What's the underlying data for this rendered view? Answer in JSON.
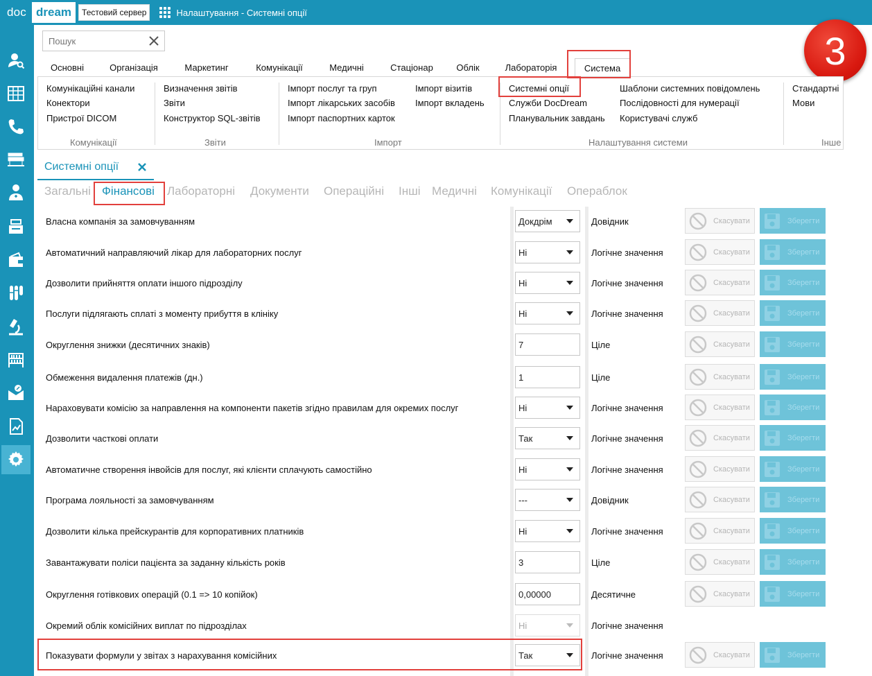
{
  "app": {
    "logo_doc": "doc",
    "logo_dream": "dream",
    "server": "Тестовий сервер",
    "window_title": "Налаштування - Системні опції",
    "step_badge": "3",
    "accent_color": "#1a93b8",
    "highlight_color": "#e2403c"
  },
  "sidebar": {
    "items": [
      {
        "icon": "user-search-icon",
        "active": false
      },
      {
        "icon": "calendar-grid-icon",
        "active": false
      },
      {
        "icon": "phone-icon",
        "active": false
      },
      {
        "icon": "hospital-bed-icon",
        "active": false
      },
      {
        "icon": "doctor-icon",
        "active": false
      },
      {
        "icon": "cash-register-icon",
        "active": false
      },
      {
        "icon": "wallet-icon",
        "active": false
      },
      {
        "icon": "test-tubes-icon",
        "active": false
      },
      {
        "icon": "microscope-icon",
        "active": false
      },
      {
        "icon": "warehouse-icon",
        "active": false
      },
      {
        "icon": "discount-envelope-icon",
        "active": false
      },
      {
        "icon": "report-icon",
        "active": false
      },
      {
        "icon": "gear-icon",
        "active": true
      }
    ]
  },
  "search": {
    "placeholder": "Пошук",
    "value": ""
  },
  "ribbon": {
    "tabs": [
      "Основні",
      "Організація",
      "Маркетинг",
      "Комунікації",
      "Медичні",
      "Стаціонар",
      "Облік",
      "Лабораторія",
      "Система"
    ],
    "active_tab": "Система",
    "groups": [
      {
        "label": "Комунікації",
        "items": [
          "Комунікаційні канали",
          "Конектори",
          "Пристрої DICOM"
        ]
      },
      {
        "label": "Звіти",
        "items": [
          "Визначення звітів",
          "Звіти",
          "Конструктор SQL-звітів"
        ]
      },
      {
        "label": "Імпорт",
        "items": [
          "Імпорт послуг та груп",
          "Імпорт лікарських засобів",
          "Імпорт паспортних карток",
          "Імпорт візитів",
          "Імпорт вкладень"
        ]
      },
      {
        "label": "Налаштування системи",
        "items": [
          "Системні опції",
          "Служби DocDream",
          "Планувальник завдань",
          "Шаблони системних повідомлень",
          "Послідовності для нумерації",
          "Користувачі служб"
        ]
      },
      {
        "label": "Інше",
        "items": [
          "Стандартні",
          "Мови"
        ]
      }
    ]
  },
  "document_tab": {
    "label": "Системні опції"
  },
  "subtabs": {
    "items": [
      "Загальні",
      "Фінансові",
      "Лабораторні",
      "Документи",
      "Операційні",
      "Інші",
      "Медичні",
      "Комунікації",
      "Операблок"
    ],
    "active": "Фінансові"
  },
  "buttons": {
    "cancel_label": "Скасувати",
    "save_label": "Зберегти"
  },
  "settings": [
    {
      "label": "Власна компанія за замовчуванням",
      "value": "Докдрім",
      "control": "select",
      "type": "Довідник",
      "actions": true
    },
    {
      "label": "Автоматичний направляючий лікар для лабораторних послуг",
      "value": "Ні",
      "control": "select",
      "type": "Логічне значення",
      "actions": true
    },
    {
      "label": "Дозволити прийняття оплати іншого підрозділу",
      "value": "Ні",
      "control": "select",
      "type": "Логічне значення",
      "actions": true
    },
    {
      "label": "Послуги підлягають сплаті з моменту прибуття в клініку",
      "value": "Ні",
      "control": "select",
      "type": "Логічне значення",
      "actions": true
    },
    {
      "label": "Округлення знижки (десятичних знаків)",
      "value": "7",
      "control": "text",
      "type": "Ціле",
      "actions": true
    },
    {
      "label": "Обмеження видалення платежів (дн.)",
      "value": "1",
      "control": "text",
      "type": "Ціле",
      "actions": true
    },
    {
      "label": "Нараховувати комісію за направлення на компоненти пакетів згідно правилам для окремих послуг",
      "value": "Ні",
      "control": "select",
      "type": "Логічне значення",
      "actions": true
    },
    {
      "label": "Дозволити часткові оплати",
      "value": "Так",
      "control": "select",
      "type": "Логічне значення",
      "actions": true
    },
    {
      "label": "Автоматичне створення інвойсів для послуг, які клієнти сплачують самостійно",
      "value": "Ні",
      "control": "select",
      "type": "Логічне значення",
      "actions": true
    },
    {
      "label": "Програма лояльності за замовчуванням",
      "value": "---",
      "control": "select",
      "type": "Довідник",
      "actions": true
    },
    {
      "label": "Дозволити кілька прейскурантів для корпоративних платників",
      "value": "Ні",
      "control": "select",
      "type": "Логічне значення",
      "actions": true
    },
    {
      "label": "Завантажувати поліси пацієнта за заданну кількість років",
      "value": "3",
      "control": "text",
      "type": "Ціле",
      "actions": true
    },
    {
      "label": "Округлення готівкових операцій (0.1 => 10 копійок)",
      "value": "0,00000",
      "control": "text",
      "type": "Десятичне",
      "actions": true
    },
    {
      "label": "Окремий облік комісійних виплат по підрозділах",
      "value": "Ні",
      "control": "select-disabled",
      "type": "Логічне значення",
      "actions": false
    },
    {
      "label": "Показувати формули у звітах з нарахування комісійних",
      "value": "Так",
      "control": "select",
      "type": "Логічне значення",
      "actions": true
    }
  ]
}
